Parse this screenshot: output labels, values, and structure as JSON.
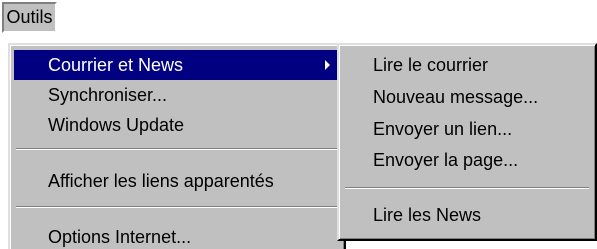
{
  "menubar": {
    "outils_label": "Outils"
  },
  "tools_menu": {
    "items": [
      {
        "label": "Courrier et News",
        "has_submenu": true,
        "highlighted": true
      },
      {
        "label": "Synchroniser..."
      },
      {
        "label": "Windows Update"
      },
      {
        "label": "Afficher les liens apparentés"
      },
      {
        "label": "Options Internet..."
      }
    ]
  },
  "mail_submenu": {
    "items": [
      {
        "label": "Lire le courrier"
      },
      {
        "label": "Nouveau message..."
      },
      {
        "label": "Envoyer un lien..."
      },
      {
        "label": "Envoyer la page..."
      },
      {
        "label": "Lire les News"
      }
    ]
  },
  "colors": {
    "menu_face": "#c0c0c0",
    "highlight": "#000080",
    "highlight_text": "#ffffff"
  }
}
